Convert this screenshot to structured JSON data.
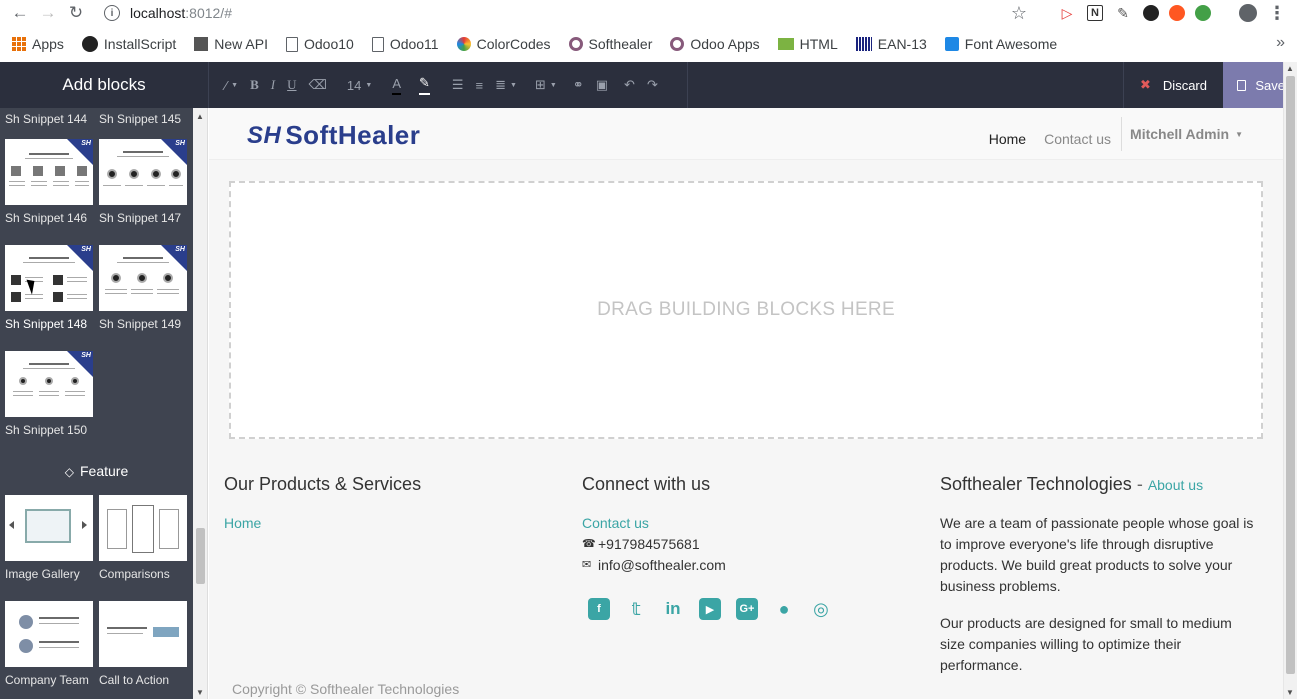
{
  "browser": {
    "url_host": "localhost",
    "url_rest": ":8012/#"
  },
  "bookmarks": [
    "Apps",
    "InstallScript",
    "New API",
    "Odoo10",
    "Odoo11",
    "ColorCodes",
    "Softhealer",
    "Odoo Apps",
    "HTML",
    "EAN-13",
    "Font Awesome"
  ],
  "editor": {
    "title": "Add blocks",
    "font_size": "14",
    "discard_label": "Discard",
    "save_label": "Save"
  },
  "sidebar": {
    "snippets": [
      {
        "label": "Sh Snippet 144"
      },
      {
        "label": "Sh Snippet 145"
      },
      {
        "label": "Sh Snippet 146"
      },
      {
        "label": "Sh Snippet 147"
      },
      {
        "label": "Sh Snippet 148"
      },
      {
        "label": "Sh Snippet 149"
      },
      {
        "label": "Sh Snippet 150"
      }
    ],
    "badge": "SH",
    "feature_heading": "Feature",
    "feature_blocks": [
      {
        "label": "Image Gallery"
      },
      {
        "label": "Comparisons"
      },
      {
        "label": "Company Team"
      },
      {
        "label": "Call to Action"
      }
    ]
  },
  "site": {
    "logo_mark": "SH",
    "logo_text": "SoftHealer",
    "nav": [
      "Home",
      "Contact us"
    ],
    "user": "Mitchell Admin",
    "dropzone_text": "DRAG BUILDING BLOCKS HERE"
  },
  "footer": {
    "col1_title": "Our Products & Services",
    "col1_link": "Home",
    "col2_title": "Connect with us",
    "col2_link": "Contact us",
    "phone": "+917984575681",
    "email": "info@softhealer.com",
    "col3_title": "Softhealer Technologies",
    "col3_sep": " - ",
    "col3_about": "About us",
    "para1": "We are a team of passionate people whose goal is to improve everyone's life through disruptive products. We build great products to solve your business problems.",
    "para2": "Our products are designed for small to medium size companies willing to optimize their performance.",
    "copyright": "Copyright © Softhealer Technologies"
  },
  "social_icons": [
    "facebook-icon",
    "twitter-icon",
    "linkedin-icon",
    "youtube-icon",
    "google-plus-icon",
    "github-icon",
    "instagram-icon"
  ],
  "colors": {
    "editor_bar": "#2b2f3d",
    "sidebar": "#3f4450",
    "save": "#7c7bad",
    "accent": "#3ba5a5",
    "brand": "#2a3e8c"
  }
}
